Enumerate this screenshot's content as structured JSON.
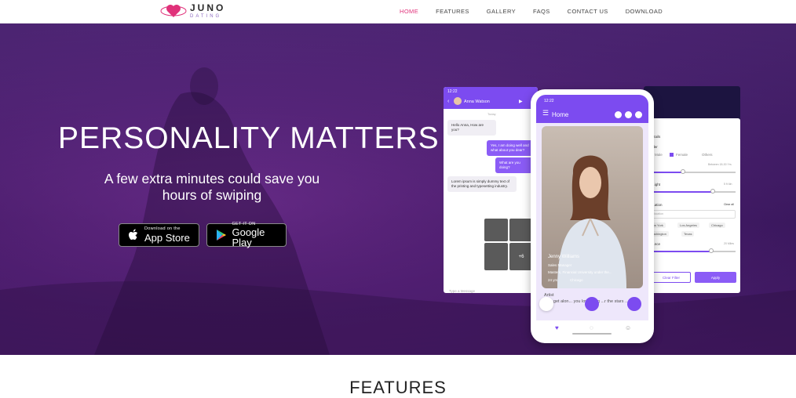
{
  "brand": {
    "name": "JUNO",
    "sub": "DATING",
    "color": "#e0317a"
  },
  "nav": {
    "items": [
      "HOME",
      "FEATURES",
      "GALLERY",
      "FAQS",
      "CONTACT US",
      "DOWNLOAD"
    ],
    "active": "HOME"
  },
  "hero": {
    "headline": "PERSONALITY MATTERS",
    "subline": "A few extra minutes could save you hours of swiping",
    "apple": {
      "small": "Download on the",
      "big": "App Store"
    },
    "google": {
      "small": "GET IT ON",
      "big": "Google Play"
    }
  },
  "chat": {
    "time": "12:22",
    "contact": "Anna Watson",
    "day": "Today",
    "messages": [
      {
        "dir": "in",
        "text": "Hello Anna, How are you?"
      },
      {
        "dir": "out",
        "text": "Yes, I am doing well and what about you dear?"
      },
      {
        "dir": "out",
        "text": "What are you doing?"
      },
      {
        "dir": "in",
        "text": "Lorem ipsum is simply dummy text of the printing and typesetting industry."
      }
    ],
    "photo_count_more": "+6",
    "input_placeholder": "Type a Message"
  },
  "phone": {
    "time": "12:22",
    "title": "Home",
    "profile_name": "Jenny Williams",
    "job": "Sales Manager",
    "education": "Masters, Financial University under the...",
    "age": "24 yrs",
    "city": "Chicago",
    "about_title": "Artist",
    "about_text": "...ay get alon... you love lying ...r the stars ...at"
  },
  "filter": {
    "section": "...n Details",
    "gender_label": "...nder",
    "gender_options": [
      "Male",
      "Female",
      "Others"
    ],
    "age_label": "...e Range",
    "age_value": "Between 18-30 Yrs",
    "height_label": "...ight",
    "height_value": "5 ft 6in",
    "location_label": "...ation",
    "clear_all": "Clear all",
    "location_placeholder": "...location",
    "chips": [
      "New York",
      "Los Angeles",
      "Chicago",
      "Washington",
      "Texas"
    ],
    "distance_label": "...nce",
    "distance_value": "20 Miles",
    "clear_btn": "Clear Filter",
    "apply_btn": "Apply"
  },
  "sections": {
    "features_title": "FEATURES"
  },
  "colors": {
    "accent": "#7c4bf0",
    "hero_bg": "#4b1f6e",
    "pink": "#e0317a"
  }
}
